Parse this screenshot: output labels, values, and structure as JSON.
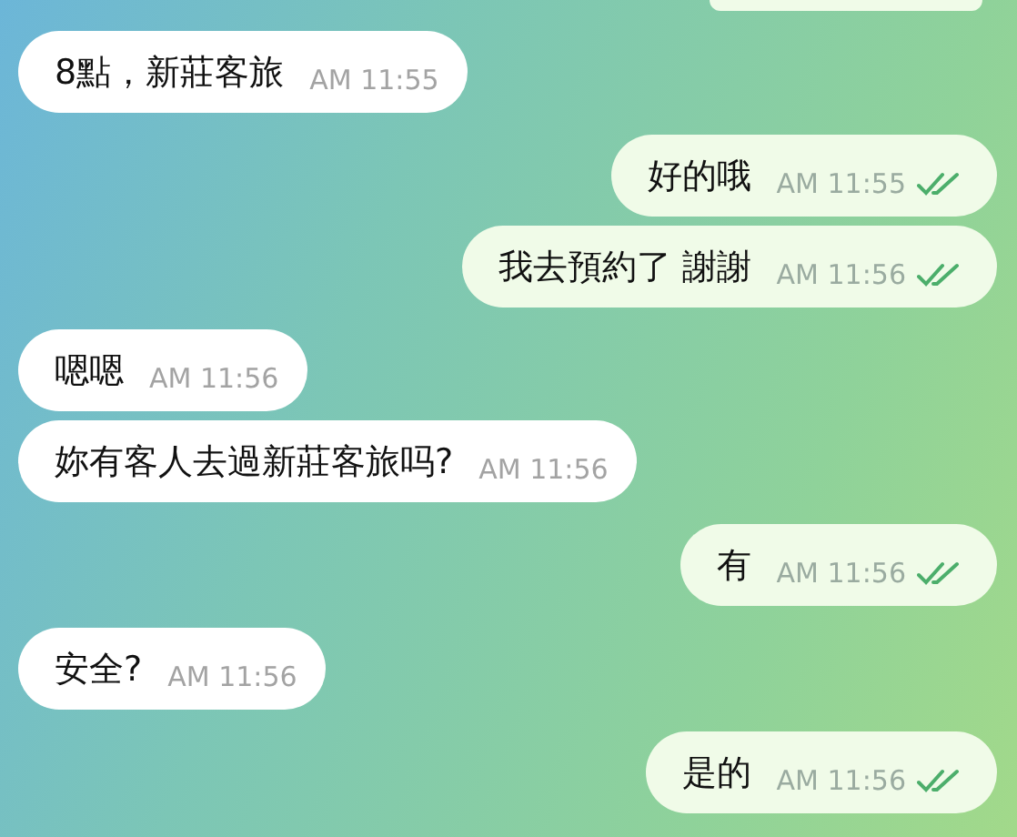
{
  "messages": [
    {
      "kind": "in",
      "text": "8點，新莊客旅",
      "time": "AM 11:55"
    },
    {
      "kind": "out",
      "text": "好的哦",
      "time": "AM 11:55",
      "read": true
    },
    {
      "kind": "out",
      "text": "我去預約了 謝謝",
      "time": "AM 11:56",
      "read": true
    },
    {
      "kind": "in",
      "text": "嗯嗯",
      "time": "AM 11:56"
    },
    {
      "kind": "in",
      "text": "妳有客人去過新莊客旅吗?",
      "time": "AM 11:56"
    },
    {
      "kind": "out",
      "text": "有",
      "time": "AM 11:56",
      "read": true
    },
    {
      "kind": "in",
      "text": "安全?",
      "time": "AM 11:56"
    },
    {
      "kind": "out",
      "text": "是的",
      "time": "AM 11:56",
      "read": true
    }
  ]
}
